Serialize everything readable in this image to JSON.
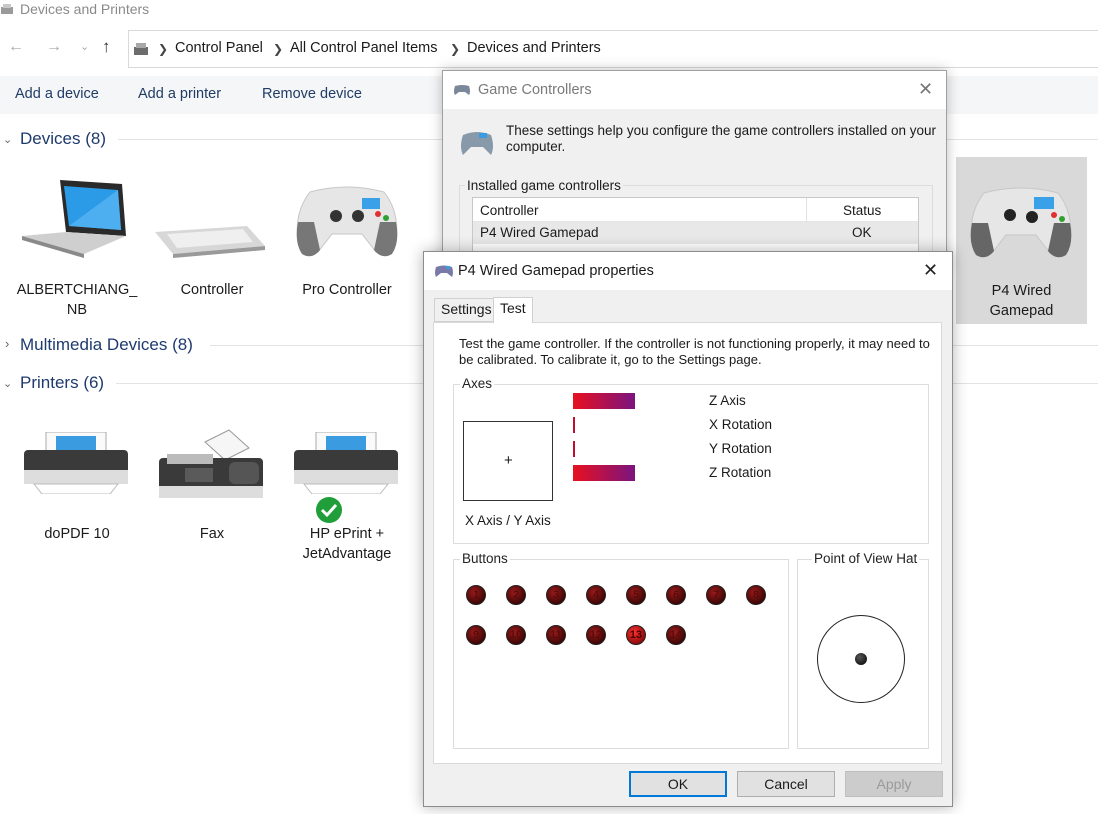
{
  "window": {
    "title": "Devices and Printers"
  },
  "breadcrumb": [
    "Control Panel",
    "All Control Panel Items",
    "Devices and Printers"
  ],
  "commands": {
    "add_device": "Add a device",
    "add_printer": "Add a printer",
    "remove_device": "Remove device"
  },
  "groups": {
    "devices": {
      "label": "Devices",
      "count": "(8)"
    },
    "multimedia": {
      "label": "Multimedia Devices",
      "count": "(8)"
    },
    "printers": {
      "label": "Printers",
      "count": "(6)"
    }
  },
  "devices": [
    {
      "label": "ALBERTCHIANG_\nNB",
      "icon": "laptop-icon"
    },
    {
      "label": "Controller",
      "icon": "keyboard-icon"
    },
    {
      "label": "Pro Controller",
      "icon": "gamepad-icon"
    },
    {
      "label": "P4 Wired\nGamepad",
      "icon": "gamepad-icon"
    }
  ],
  "printers": [
    {
      "label": "doPDF 10",
      "icon": "printer-icon"
    },
    {
      "label": "Fax",
      "icon": "fax-icon"
    },
    {
      "label": "HP ePrint +\nJetAdvantage",
      "icon": "printer-icon",
      "default": true
    }
  ],
  "game_controllers": {
    "title": "Game Controllers",
    "description": "These settings help you configure the game controllers installed on your computer.",
    "installed_label": "Installed game controllers",
    "columns": [
      "Controller",
      "Status"
    ],
    "rows": [
      {
        "controller": "P4 Wired Gamepad",
        "status": "OK"
      }
    ]
  },
  "properties": {
    "title": "P4 Wired Gamepad properties",
    "tabs": [
      "Settings",
      "Test"
    ],
    "active_tab": "Test",
    "instructions": "Test the game controller.  If the controller is not functioning properly, it may need to be calibrated.  To calibrate it, go to the Settings page.",
    "axes_label": "Axes",
    "xy_label": "X Axis / Y Axis",
    "axes": [
      {
        "label": "Z Axis",
        "level": 0.55
      },
      {
        "label": "X Rotation",
        "level": 0.0
      },
      {
        "label": "Y Rotation",
        "level": 0.0
      },
      {
        "label": "Z Rotation",
        "level": 0.55
      }
    ],
    "buttons_label": "Buttons",
    "buttons": [
      "1",
      "2",
      "3",
      "4",
      "5",
      "6",
      "7",
      "8",
      "9",
      "10",
      "11",
      "12",
      "13",
      "14"
    ],
    "pressed_buttons": [
      "13"
    ],
    "pov_label": "Point of View Hat",
    "ok": "OK",
    "cancel": "Cancel",
    "apply": "Apply"
  },
  "colors": {
    "accent": "#0078d7",
    "link": "#1e3a6e",
    "axis_bar_start": "#e8101f",
    "axis_bar_end": "#7a1480"
  }
}
